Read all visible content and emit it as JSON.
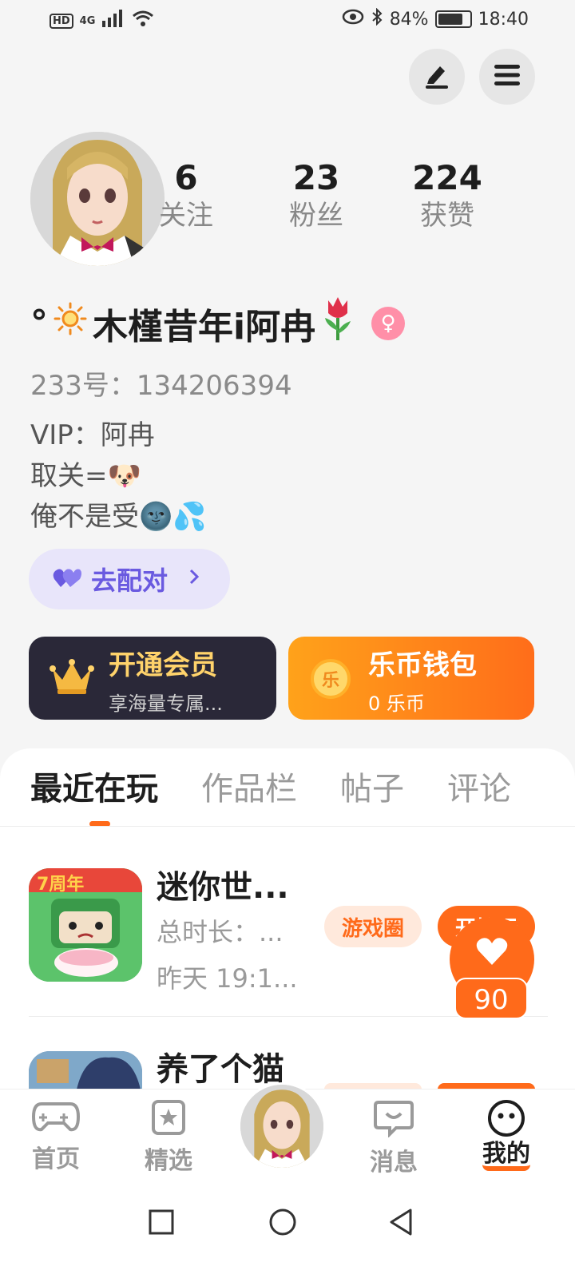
{
  "status_bar": {
    "hd": "HD",
    "network": "4G",
    "battery": "84%",
    "time": "18:40"
  },
  "profile": {
    "stats": [
      {
        "value": "6",
        "label": "关注"
      },
      {
        "value": "23",
        "label": "粉丝"
      },
      {
        "value": "224",
        "label": "获赞"
      }
    ],
    "nickname_prefix": "°",
    "nickname": "木槿昔年i阿冉",
    "uid": "233号：134206394",
    "bio": "VIP：阿冉\n取关=🐶\n俺不是受🌚💦",
    "gender_symbol": "♀"
  },
  "match_button": {
    "label": "去配对"
  },
  "cards": {
    "vip": {
      "title": "开通会员",
      "subtitle": "享海量专属..."
    },
    "wallet": {
      "title": "乐币钱包",
      "subtitle": "0 乐币",
      "coin_char": "乐"
    }
  },
  "tabs": [
    "最近在玩",
    "作品栏",
    "帖子",
    "评论"
  ],
  "games": [
    {
      "name": "迷你世...",
      "total_time": "总时长：...",
      "last_played": "昨天 19:1...",
      "circle_btn": "游戏圈",
      "play_btn": "开始玩",
      "icon_text": "7周年"
    },
    {
      "name": "养了个猫"
    }
  ],
  "favorite": {
    "count": "90"
  },
  "bottom_nav": [
    "首页",
    "精选",
    "消息",
    "我的"
  ],
  "colors": {
    "accent": "#ff6a1a",
    "match_purple": "#6a5ae0",
    "vip_dark": "#2a2838"
  }
}
